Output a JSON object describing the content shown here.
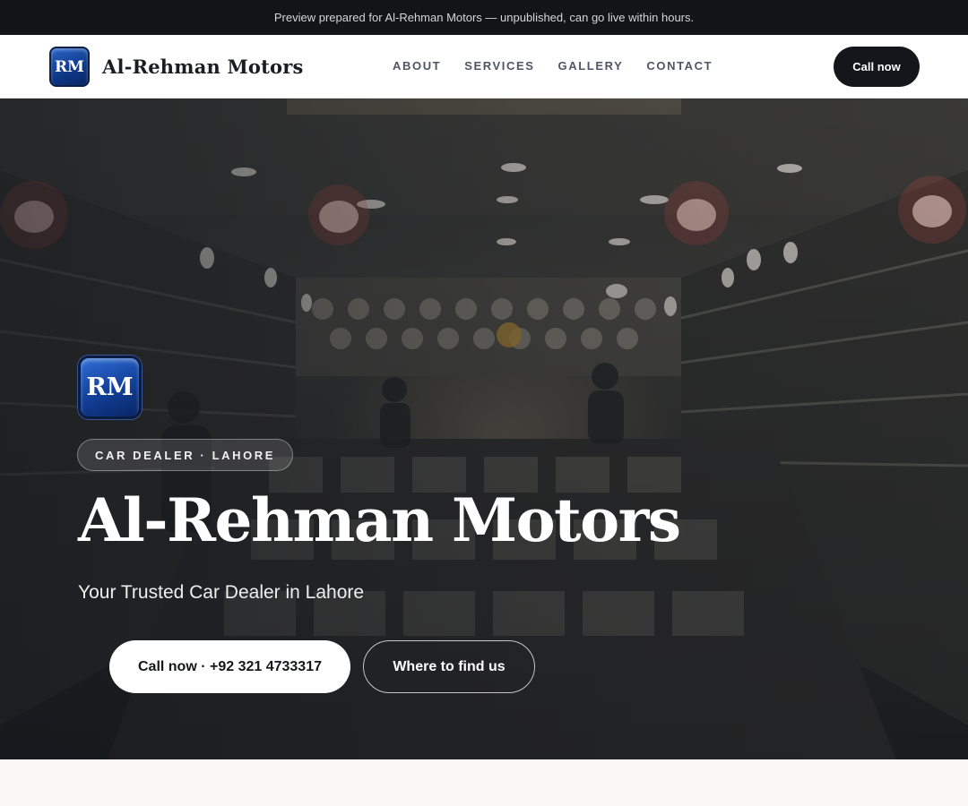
{
  "preview_banner": "Preview prepared for Al-Rehman Motors — unpublished, can go live within hours.",
  "brand": {
    "logo_text": "RM",
    "name": "Al-Rehman Motors"
  },
  "nav": {
    "links": [
      "ABOUT",
      "SERVICES",
      "GALLERY",
      "CONTACT"
    ],
    "cta": "Call now"
  },
  "hero": {
    "logo_text": "RM",
    "tag": "CAR DEALER · LAHORE",
    "title": "Al-Rehman Motors",
    "subtitle": "Your Trusted Car Dealer in Lahore",
    "primary_button": "Call now · +92 321 4733317",
    "secondary_button": "Where to find us"
  },
  "colors": {
    "topbar_bg": "#121418",
    "nav_cta_bg": "#14161b",
    "logo_blue": "#0f3a8c",
    "page_bg": "#f9f8f5"
  }
}
